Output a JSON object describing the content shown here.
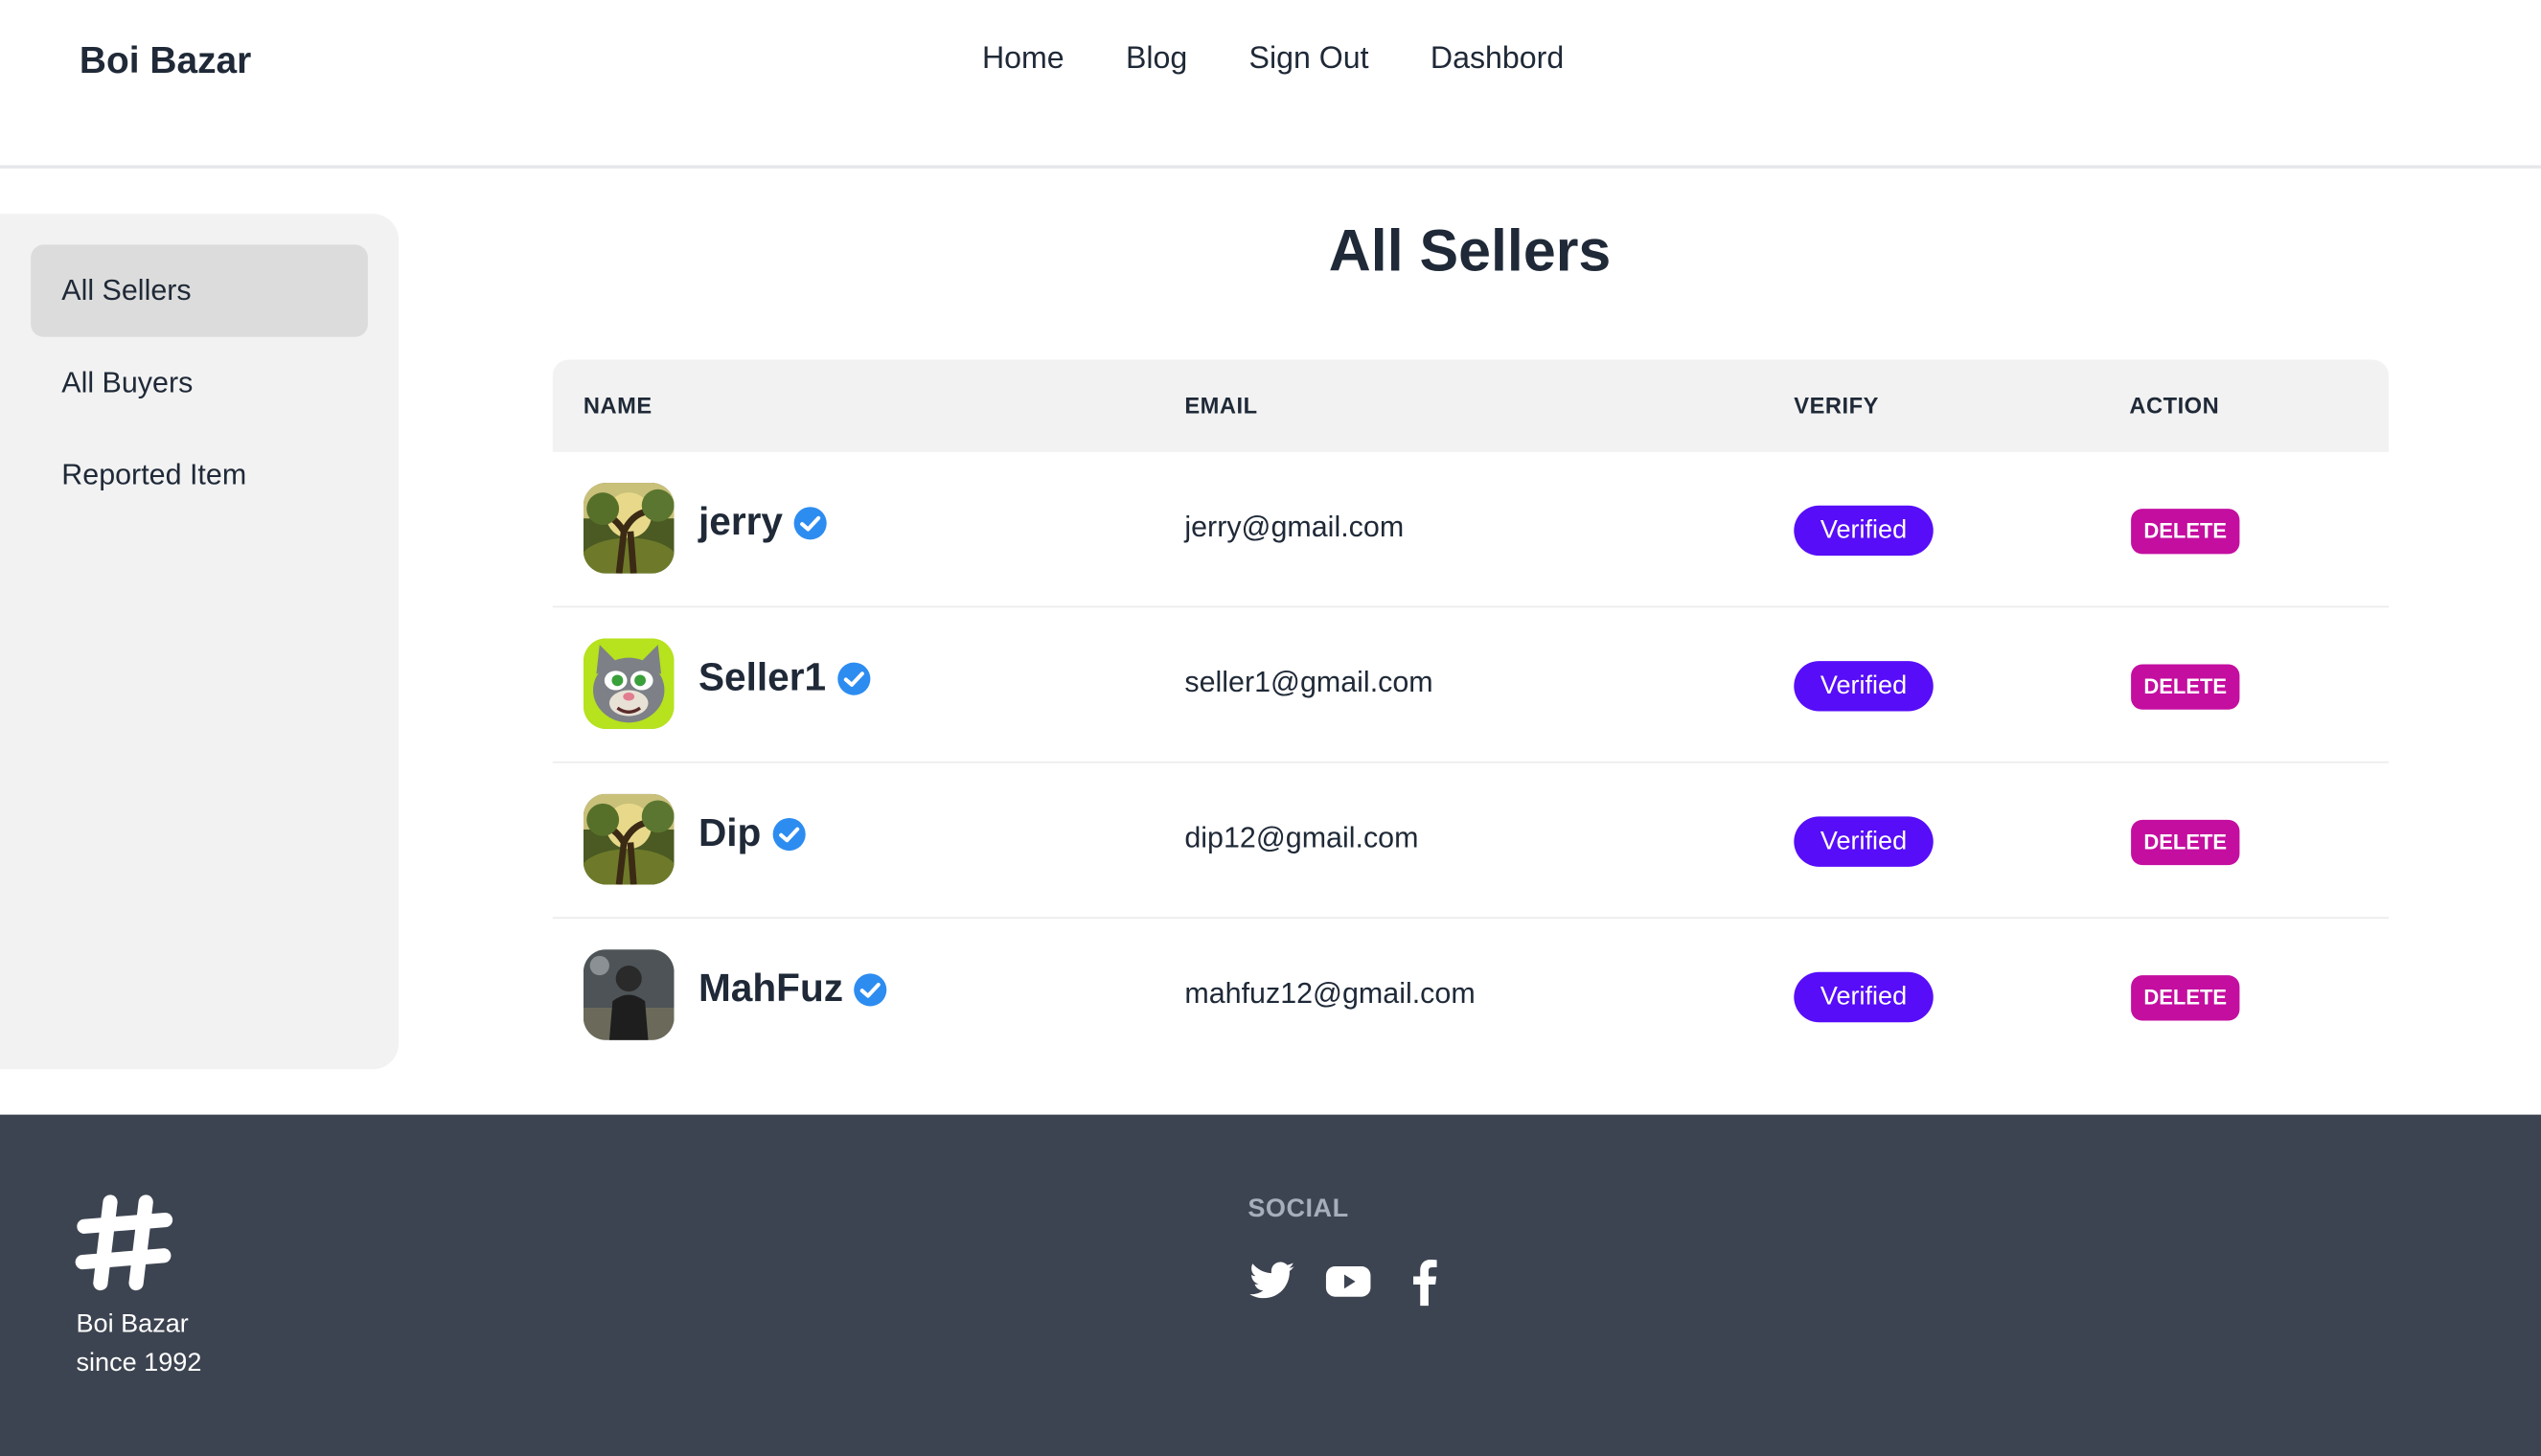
{
  "navbar": {
    "brand": "Boi Bazar",
    "links": [
      "Home",
      "Blog",
      "Sign Out",
      "Dashbord"
    ]
  },
  "sidebar": {
    "items": [
      {
        "label": "All Sellers",
        "active": true
      },
      {
        "label": "All Buyers",
        "active": false
      },
      {
        "label": "Reported Item",
        "active": false
      }
    ]
  },
  "main": {
    "title": "All Sellers",
    "columns": [
      "NAME",
      "EMAIL",
      "VERIFY",
      "ACTION"
    ],
    "rows": [
      {
        "name": "jerry",
        "email": "jerry@gmail.com",
        "verify": "Verified",
        "action": "DELETE",
        "avatar": "forest-image"
      },
      {
        "name": "Seller1",
        "email": "seller1@gmail.com",
        "verify": "Verified",
        "action": "DELETE",
        "avatar": "cat-cartoon-image"
      },
      {
        "name": "Dip",
        "email": "dip12@gmail.com",
        "verify": "Verified",
        "action": "DELETE",
        "avatar": "forest-image"
      },
      {
        "name": "MahFuz",
        "email": "mahfuz12@gmail.com",
        "verify": "Verified",
        "action": "DELETE",
        "avatar": "person-photo-image"
      }
    ]
  },
  "footer": {
    "brand_line1": "Boi Bazar",
    "brand_line2": "since 1992",
    "social_title": "SOCIAL",
    "icons": [
      "twitter-icon",
      "youtube-icon",
      "facebook-icon"
    ]
  },
  "colors": {
    "primary": "#570df8",
    "secondary": "#c40ea0",
    "footer_bg": "#3d4451",
    "verified_badge": "#2d8cf0"
  }
}
